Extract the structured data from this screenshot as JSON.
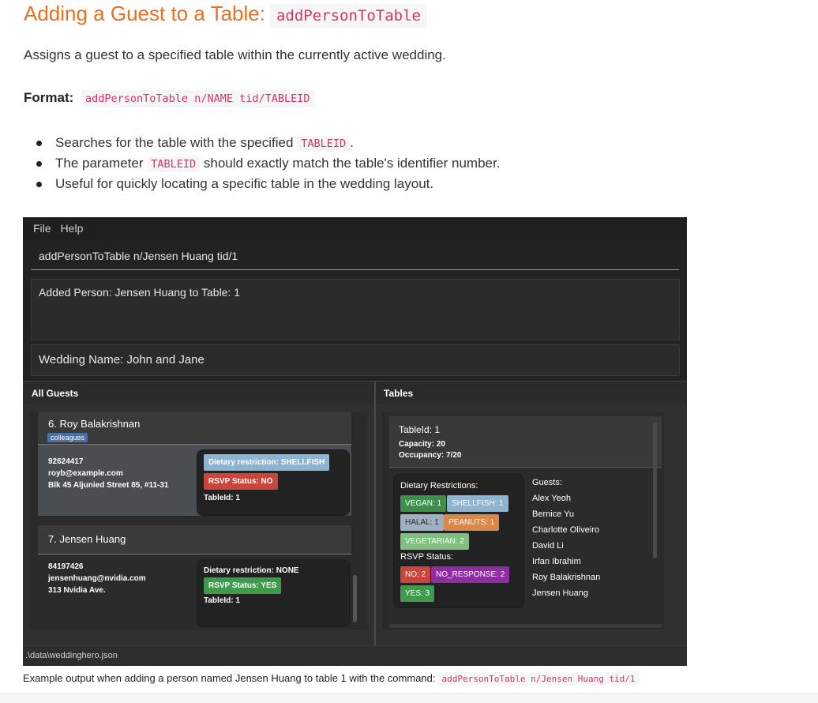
{
  "doc": {
    "heading_text": "Adding a Guest to a Table:",
    "heading_code": "addPersonToTable",
    "description": "Assigns a guest to a specified table within the currently active wedding.",
    "format_label": "Format:",
    "format_code": "addPersonToTable n/NAME tid/TABLEID",
    "bullets": [
      {
        "pre": "Searches for the table with the specified ",
        "code": "TABLEID",
        "post": "."
      },
      {
        "pre": "The parameter ",
        "code": "TABLEID",
        "post": " should exactly match the table's identifier number."
      },
      {
        "pre": "Useful for quickly locating a specific table in the wedding layout.",
        "code": "",
        "post": ""
      }
    ],
    "caption_text": "Example output when adding a person named Jensen Huang to table 1 with the command:",
    "caption_code": "addPersonToTable n/Jensen Huang tid/1"
  },
  "app": {
    "menu": [
      "File",
      "Help"
    ],
    "command_input": "addPersonToTable n/Jensen Huang tid/1",
    "result_text": "Added Person: Jensen Huang to Table: 1",
    "wedding_name": "Wedding Name: John and Jane",
    "guests_header": "All Guests",
    "tables_header": "Tables",
    "status_path": ".\\data\\weddinghero.json",
    "guests": [
      {
        "name": "6. Roy Balakrishnan",
        "tag": "colleagues",
        "phone": "92624417",
        "email": "royb@example.com",
        "address": "Blk 45 Aljunied Street 85, #11-31",
        "dietary": "Dietary restriction: SHELLFISH",
        "rsvp": "RSVP Status: NO",
        "table_id": "TableId: 1"
      },
      {
        "name": "7. Jensen Huang",
        "phone": "84197426",
        "email": "jensenhuang@nvidia.com",
        "address": "313 Nvidia Ave.",
        "dietary": "Dietary restriction: NONE",
        "rsvp": "RSVP Status: YES",
        "table_id": "TableId: 1"
      }
    ],
    "table": {
      "id": "TableId: 1",
      "capacity": "Capacity: 20",
      "occupancy": "Occupancy: 7/20",
      "dietary_label": "Dietary Restrictions:",
      "dietary_pills": [
        "VEGAN: 1",
        "SHELLFISH: 1",
        "HALAL: 1",
        "PEANUTS: 1",
        "VEGETARIAN: 2"
      ],
      "rsvp_label": "RSVP Status:",
      "rsvp_pills": [
        "NO: 2",
        "NO_RESPONSE: 2",
        "YES: 3"
      ],
      "guests_label": "Guests:",
      "guest_names": [
        "Alex Yeoh",
        "Bernice Yu",
        "Charlotte Oliveiro",
        "David Li",
        "Irfan Ibrahim",
        "Roy Balakrishnan",
        "Jensen Huang"
      ]
    },
    "colors": {
      "heading_orange": "#e76f1e",
      "code_pink": "#d6336c",
      "tag_blue": "#4a6fa5",
      "pill_shellfish": "#8fb4d1",
      "pill_no": "#c9463d",
      "pill_yes": "#3f9a4b",
      "pill_vegan": "#3e8e4e",
      "pill_halal": "#9fb0c3",
      "pill_peanuts": "#d9884a",
      "pill_vegetarian": "#7fbf7f",
      "pill_no_response": "#8e2da2"
    }
  }
}
